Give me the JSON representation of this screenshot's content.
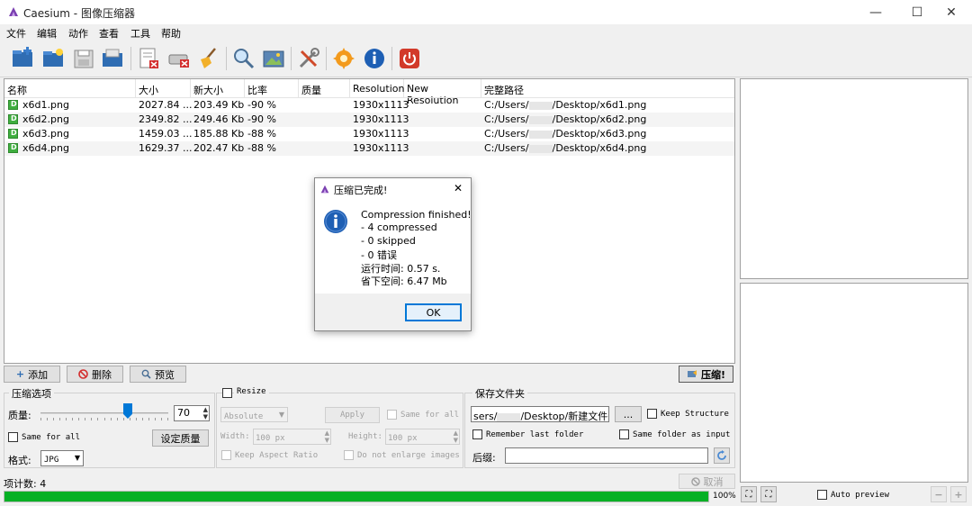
{
  "window": {
    "title": "Caesium - 图像压缩器",
    "min": "—",
    "max": "☐",
    "close": "✕"
  },
  "menu": [
    "文件",
    "编辑",
    "动作",
    "查看",
    "工具",
    "帮助"
  ],
  "table": {
    "columns": [
      "名称",
      "大小",
      "新大小",
      "比率",
      "质量",
      "Resolution",
      "New Resolution",
      "完整路径"
    ],
    "rows": [
      {
        "name": "x6d1.png",
        "size": "2027.84 ...",
        "new_size": "203.49 Kb",
        "ratio": "-90 %",
        "quality": "",
        "resolution": "1930x1113",
        "new_resolution": "",
        "path": "C:/Users/",
        "path_end": "/Desktop/x6d1.png"
      },
      {
        "name": "x6d2.png",
        "size": "2349.82 ...",
        "new_size": "249.46 Kb",
        "ratio": "-90 %",
        "quality": "",
        "resolution": "1930x1113",
        "new_resolution": "",
        "path": "C:/Users/",
        "path_end": "/Desktop/x6d2.png"
      },
      {
        "name": "x6d3.png",
        "size": "1459.03 ...",
        "new_size": "185.88 Kb",
        "ratio": "-88 %",
        "quality": "",
        "resolution": "1930x1113",
        "new_resolution": "",
        "path": "C:/Users/",
        "path_end": "/Desktop/x6d3.png"
      },
      {
        "name": "x6d4.png",
        "size": "1629.37 ...",
        "new_size": "202.47 Kb",
        "ratio": "-88 %",
        "quality": "",
        "resolution": "1930x1113",
        "new_resolution": "",
        "path": "C:/Users/",
        "path_end": "/Desktop/x6d4.png"
      }
    ]
  },
  "actions": {
    "add": "添加",
    "delete": "删除",
    "preview": "预览",
    "compress": "压缩!"
  },
  "compression": {
    "title": "压缩选项",
    "quality_label": "质量:",
    "quality_value": "70",
    "quality_fraction": 0.7,
    "same_for_all": "Same for all",
    "set_quality": "设定质量",
    "format_label": "格式:",
    "format_value": "JPG"
  },
  "resize": {
    "title": "Resize",
    "mode": "Absolute",
    "apply": "Apply",
    "same_for_all": "Same for all",
    "width_label": "Width:",
    "width_value": "100 px",
    "height_label": "Height:",
    "height_value": "100 px",
    "keep_aspect": "Keep Aspect Ratio",
    "no_enlarge": "Do not enlarge images"
  },
  "output": {
    "title": "保存文件夹",
    "path_start": "sers/",
    "path_end": "/Desktop/新建文件夹",
    "browse": "...",
    "keep_structure": "Keep Structure",
    "remember_last": "Remember last folder",
    "same_as_input": "Same folder as input",
    "suffix_label": "后缀:",
    "suffix_value": ""
  },
  "status": {
    "items": "项计数: 4",
    "cancel": "取消",
    "progress_text": "100%",
    "progress_fraction": 1.0
  },
  "preview": {
    "auto_preview": "Auto preview"
  },
  "dialog": {
    "title": "压缩已完成!",
    "lines": [
      "Compression finished!",
      "- 4 compressed",
      "- 0 skipped",
      "- 0 错误",
      "运行时间: 0.57 s.",
      "省下空间: 6.47 Mb"
    ],
    "ok": "OK"
  },
  "colors": {
    "accent": "#06b025",
    "selection": "#0078d7",
    "info": "#1e5fb4",
    "power": "#d23a2a"
  }
}
